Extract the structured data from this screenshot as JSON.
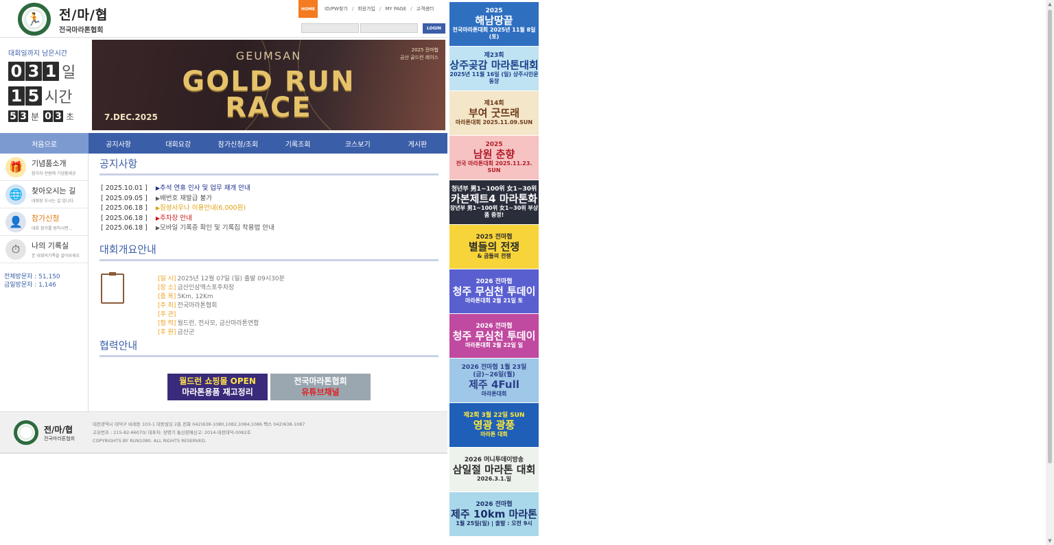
{
  "logo": {
    "title": "전/마/협",
    "subtitle": "전국마라톤협회"
  },
  "topnav": {
    "home": "HOME",
    "links": [
      "ID/PW찾기",
      "회원가입",
      "MY PAGE",
      "고객센터"
    ],
    "separator": "/",
    "login_button": "LOGIN"
  },
  "countdown": {
    "title": "대회일까지 남은시간",
    "days": [
      "0",
      "3",
      "1"
    ],
    "day_unit": "일",
    "hours": [
      "1",
      "5"
    ],
    "hour_unit": "시간",
    "minutes": [
      "5",
      "3"
    ],
    "minute_unit": "분",
    "seconds": [
      "0",
      "3"
    ],
    "second_unit": "초"
  },
  "hero": {
    "top": "GEUMSAN",
    "title_line1": "GOLD RUN",
    "title_line2": "RACE",
    "date": "7.DEC.2025",
    "tag_line1": "2025 전마협",
    "tag_line2": "금산 골드런 레이스"
  },
  "nav": {
    "items": [
      "처음으로",
      "공지사항",
      "대회요강",
      "참가신청/조회",
      "기록조회",
      "코스보기",
      "게시판"
    ]
  },
  "left_menu": [
    {
      "title": "기념품소개",
      "sub": "참가자 전원에 기념품제공",
      "icon": "gift-icon"
    },
    {
      "title": "찾아오시는 길",
      "sub": "대회장 오시는 길 입니다.",
      "icon": "globe-icon"
    },
    {
      "title": "참가신청",
      "sub": "대회 참가를 원하시면...",
      "icon": "person-icon"
    },
    {
      "title": "나의 기록실",
      "sub": "본 대회의기록을 알아보세요",
      "icon": "stopwatch-icon"
    }
  ],
  "visits": {
    "total_label": "전체방문자",
    "total": "51,150",
    "today_label": "금일방문자",
    "today": "1,146"
  },
  "notices": {
    "title": "공지사항",
    "items": [
      {
        "date": "[ 2025.10.01 ]",
        "arrow": "▶",
        "text": "추석 연휴 인사 및 업무 재개 안내",
        "color": "#1a2a8a"
      },
      {
        "date": "[ 2025.09.05 ]",
        "arrow": "▶",
        "text": "배번호 재발급 불가",
        "color": "#555555"
      },
      {
        "date": "[ 2025.06.18 ]",
        "arrow": "▶",
        "text": "짐셩사우나 이용안내(6,000원)",
        "color": "#e0a010"
      },
      {
        "date": "[ 2025.06.18 ]",
        "arrow": "▶",
        "text": "주차장 안내",
        "color": "#cc1111"
      },
      {
        "date": "[ 2025.06.18 ]",
        "arrow": "▶",
        "text": "모바일 기록증 확인 및 기록집 착용법 안내",
        "color": "#555555"
      }
    ]
  },
  "overview": {
    "title": "대회개요안내",
    "items": [
      {
        "label": "[일 시]",
        "value": "2025년 12월 07일 (일) 출발 09시30분"
      },
      {
        "label": "[장 소]",
        "value": "금산인삼엑스포주차장"
      },
      {
        "label": "[종 목]",
        "value": "5Km, 12Km"
      },
      {
        "label": "[주 최]",
        "value": "전국마라톤협회"
      },
      {
        "label": "[주 관]",
        "value": ""
      },
      {
        "label": "[협 력]",
        "value": "월드런, 전사모, 금산마라톤연합"
      },
      {
        "label": "[후 원]",
        "value": "금산군"
      }
    ]
  },
  "partners": {
    "title": "협력안내",
    "banners": [
      {
        "line1": "월드런 쇼핑몰 OPEN",
        "line2": "마라톤용품 재고정리"
      },
      {
        "line1": "전국마라톤협회",
        "line2": "유튜브채널"
      }
    ]
  },
  "footer": {
    "title": "전/마/협",
    "subtitle": "전국마라톤협회",
    "address": "대전광역시 대덕구 비래동 103-1 대동빌딩 2층 전화 042)638-1080,1082,1084,1086 팩스 042)638-1087",
    "business": "고유번호 : 215-82-66070/ 대표자: 장명기 통신판매신고: 2014-대전대덕-0082호",
    "copyright": "COPYRIGHTS BY RUN1080. ALL RIGHTS RESERVED."
  },
  "sidebar_ads": [
    {
      "l1": "2025",
      "l2": "해남땅끝",
      "l3": "전국마라톤대회 2025년 11월 8일 (토)",
      "bg": "#2f6fc0",
      "fg": "#ffffff"
    },
    {
      "l1": "제23회",
      "l2": "상주곶감 마라톤대회",
      "l3": "2025년 11월 16일 (일) 상주시민운동장",
      "bg": "#bfe3f2",
      "fg": "#1c3f8a"
    },
    {
      "l1": "제14회",
      "l2": "부여 굿뜨래",
      "l3": "마라톤대회 2025.11.09.SUN",
      "bg": "#f4e6c8",
      "fg": "#6b3a1a"
    },
    {
      "l1": "2025",
      "l2": "남원 춘향",
      "l3": "전국 마라톤대회 2025.11.23. SUN",
      "bg": "#f6c2c2",
      "fg": "#b01d2a"
    },
    {
      "l1": "청년부 男1~100위 女1~30위",
      "l2": "카본제트4 마라톤화",
      "l3": "장년부 男1~100위 女1~30위 부상품 증정!",
      "bg": "#2a2d3a",
      "fg": "#ffffff"
    },
    {
      "l1": "2025 전마협",
      "l2": "별들의 전쟁",
      "l3": "& 곰들의 전쟁",
      "bg": "#f7d43a",
      "fg": "#2a2a2a"
    },
    {
      "l1": "2026 전마협",
      "l2": "청주 무심천 투데이",
      "l3": "마라톤대회 2월 21일 토",
      "bg": "#5a5fd0",
      "fg": "#ffffff"
    },
    {
      "l1": "2026 전마협",
      "l2": "청주 무심천 투데이",
      "l3": "마라톤대회 2월 22일 일",
      "bg": "#c04aa0",
      "fg": "#ffffff"
    },
    {
      "l1": "2026 전마협 1월 23일(금)~26일(월)",
      "l2": "제주 4Full",
      "l3": "마라톤대회",
      "bg": "#9fc7e8",
      "fg": "#2a3f8a"
    },
    {
      "l1": "제2회 3월 22일 SUN",
      "l2": "영광 광풍",
      "l3": "마라톤 대회",
      "bg": "#1f5fb8",
      "fg": "#ffeb3b"
    },
    {
      "l1": "2026 머니투데이방송",
      "l2": "삼일절 마라톤 대회",
      "l3": "2026.3.1.일",
      "bg": "#eef2ec",
      "fg": "#2a2a2a"
    },
    {
      "l1": "2026 전마협",
      "l2": "제주 10km 마라톤",
      "l3": "1월 25일(일) | 출발 : 오전 9시",
      "bg": "#a8d8ea",
      "fg": "#1c2f6a"
    }
  ]
}
